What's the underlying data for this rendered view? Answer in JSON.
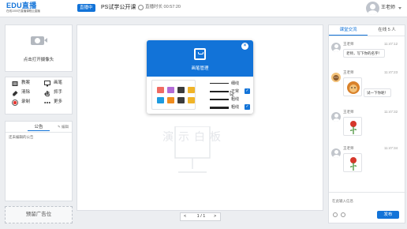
{
  "header": {
    "logo_main": "EDU直播",
    "logo_sub": "在线1000万直播课程云直播",
    "live_badge": "直播中",
    "course_title": "PS试学公开课",
    "live_time_label": "直播时长",
    "live_time": "00:57:20",
    "teacher_name": "王老师"
  },
  "camera": {
    "label": "点击打开摄像头"
  },
  "tools": [
    {
      "label": "教案",
      "icon": "lesson-plan-icon"
    },
    {
      "label": "画笔",
      "icon": "pen-icon"
    },
    {
      "label": "清除",
      "icon": "eraser-icon"
    },
    {
      "label": "抓手",
      "icon": "hand-icon"
    },
    {
      "label": "录制",
      "icon": "record-icon"
    },
    {
      "label": "更多",
      "icon": "more-icon"
    }
  ],
  "notice": {
    "title": "公告",
    "edit": "编辑",
    "text": "还未编辑的公告"
  },
  "ad": {
    "text": "预留广告位"
  },
  "board": {
    "watermark": "演示白板",
    "pager": {
      "prev": "<",
      "info": "1 / 1",
      "next": ">"
    }
  },
  "pen_modal": {
    "title": "画笔管理",
    "close": "×",
    "colors": [
      "#f06b63",
      "#b36bd6",
      "#3c3c3c",
      "#f0b429",
      "#1e9be0",
      "#f08c1e",
      "#3c3c3c",
      "#f0b429"
    ],
    "line_widths": [
      {
        "label": "细线",
        "checked": false
      },
      {
        "label": "正常",
        "checked": true
      },
      {
        "label": "粗线",
        "checked": false
      },
      {
        "label": "粗线",
        "checked": true
      }
    ]
  },
  "chat": {
    "tab_active": "课堂交流",
    "tab_online": "在线 5 人",
    "messages": [
      {
        "name": "王老师",
        "time": "11:47:12",
        "text": "老师，写下你的名字！"
      },
      {
        "name": "王老师",
        "time": "11:47:23",
        "text": "试一下你呢！"
      },
      {
        "name": "王老师",
        "time": "11:47:32",
        "text": ""
      },
      {
        "name": "王老师",
        "time": "11:47:34",
        "text": ""
      }
    ],
    "input_placeholder": "在此输入信息",
    "send_label": "发布"
  }
}
